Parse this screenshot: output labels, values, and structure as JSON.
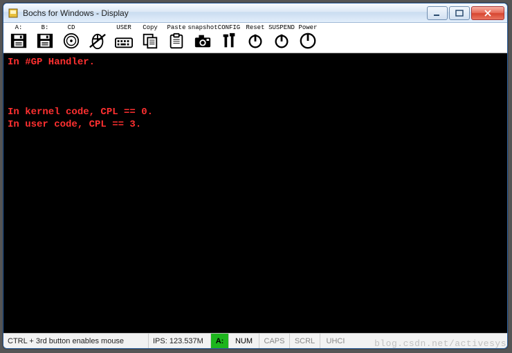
{
  "window": {
    "title": "Bochs for Windows - Display"
  },
  "toolbar": {
    "items": [
      {
        "label": "A:",
        "name": "drive-a-button",
        "icon": "floppy"
      },
      {
        "label": "B:",
        "name": "drive-b-button",
        "icon": "floppy"
      },
      {
        "label": "CD",
        "name": "drive-cd-button",
        "icon": "cd"
      },
      {
        "label": "",
        "name": "mouse-capture-button",
        "icon": "mouse-off"
      },
      {
        "label": "USER",
        "name": "user-button",
        "icon": "keyboard"
      },
      {
        "label": "Copy",
        "name": "copy-button",
        "icon": "copy"
      },
      {
        "label": "Paste",
        "name": "paste-button",
        "icon": "paste"
      },
      {
        "label": "snapshot",
        "name": "snapshot-button",
        "icon": "camera"
      },
      {
        "label": "CONFIG",
        "name": "config-button",
        "icon": "tools"
      },
      {
        "label": "Reset",
        "name": "reset-button",
        "icon": "power"
      },
      {
        "label": "SUSPEND",
        "name": "suspend-button",
        "icon": "power"
      },
      {
        "label": "Power",
        "name": "power-button",
        "icon": "power-ring"
      }
    ]
  },
  "console": {
    "lines": [
      "In #GP Handler.",
      "",
      "",
      "",
      "In kernel code, CPL == 0.",
      "In user code, CPL == 3."
    ]
  },
  "status": {
    "mouse_hint": "CTRL + 3rd button enables mouse",
    "ips": "IPS: 123.537M",
    "drive_a": "A:",
    "num": "NUM",
    "caps": "CAPS",
    "scrl": "SCRL",
    "uhci": "UHCI"
  },
  "watermark": "blog.csdn.net/activesys"
}
